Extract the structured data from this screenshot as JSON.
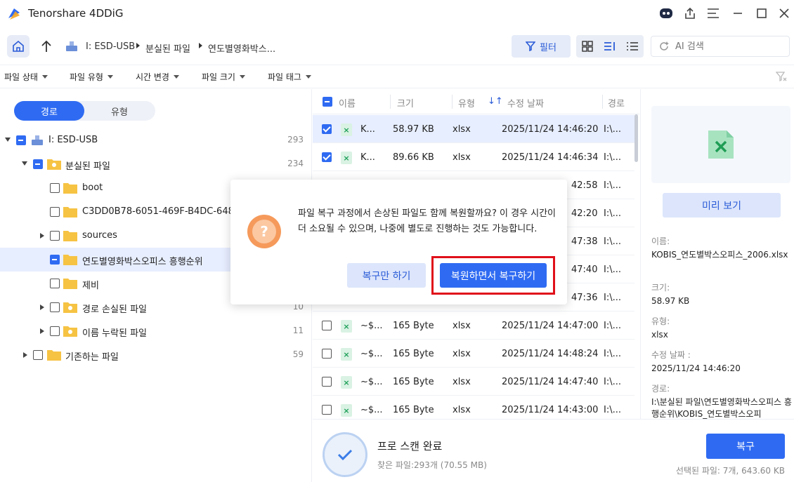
{
  "app": {
    "title": "Tenorshare 4DDiG"
  },
  "breadcrumb": {
    "drive": "I: ESD-USB",
    "folder": "분실된 파일",
    "current": "연도별영화박스..."
  },
  "toolbar": {
    "filter_label": "필터",
    "search_placeholder": "AI 검색"
  },
  "filters": [
    "파일 상태",
    "파일 유형",
    "시간 변경",
    "파일 크기",
    "파일 태그"
  ],
  "left": {
    "toggle": {
      "path": "경로",
      "type": "유형"
    },
    "tree": [
      {
        "label": "I: ESD-USB",
        "count": "293"
      },
      {
        "label": "분실된 파일",
        "count": "234"
      },
      {
        "label": "boot",
        "count": ""
      },
      {
        "label": "C3DD0B78-6051-469F-B4DC-6482",
        "count": ""
      },
      {
        "label": "sources",
        "count": ""
      },
      {
        "label": "연도별영화박스오피스 흥행순위",
        "count": ""
      },
      {
        "label": "제비",
        "count": ""
      },
      {
        "label": "경로 손실된 파일",
        "count": "10"
      },
      {
        "label": "이름 누락된 파일",
        "count": "11"
      },
      {
        "label": "기존하는 파일",
        "count": "59"
      }
    ]
  },
  "list": {
    "headers": {
      "name": "이름",
      "size": "크기",
      "type": "유형",
      "date": "수정 날짜",
      "path": "경로"
    },
    "rows": [
      {
        "name": "K...",
        "size": "58.97 KB",
        "type": "xlsx",
        "date": "2025/11/24 14:46:20",
        "path": "I:\\..."
      },
      {
        "name": "K...",
        "size": "89.66 KB",
        "type": "xlsx",
        "date": "2025/11/24 14:46:34",
        "path": "I:\\..."
      },
      {
        "name": "",
        "size": "",
        "type": "",
        "date": "42:58",
        "path": "I:\\..."
      },
      {
        "name": "",
        "size": "",
        "type": "",
        "date": "42:20",
        "path": "I:\\..."
      },
      {
        "name": "",
        "size": "",
        "type": "",
        "date": "47:38",
        "path": "I:\\..."
      },
      {
        "name": "",
        "size": "",
        "type": "",
        "date": "47:40",
        "path": "I:\\..."
      },
      {
        "name": "",
        "size": "",
        "type": "",
        "date": "47:36",
        "path": "I:\\..."
      },
      {
        "name": "~$...",
        "size": "165 Byte",
        "type": "xlsx",
        "date": "2025/11/24 14:47:00",
        "path": "I:\\..."
      },
      {
        "name": "~$...",
        "size": "165 Byte",
        "type": "xlsx",
        "date": "2025/11/24 14:48:24",
        "path": "I:\\..."
      },
      {
        "name": "~$...",
        "size": "165 Byte",
        "type": "xlsx",
        "date": "2025/11/24 14:47:40",
        "path": "I:\\..."
      },
      {
        "name": "~$...",
        "size": "165 Byte",
        "type": "xlsx",
        "date": "2025/11/24 14:43:00",
        "path": "I:\\..."
      }
    ]
  },
  "preview": {
    "button": "미리 보기",
    "name_label": "이름:",
    "name_value": "KOBIS_연도별박스오피스_2006.xlsx",
    "size_label": "크기:",
    "size_value": "58.97 KB",
    "type_label": "유형:",
    "type_value": "xlsx",
    "date_label": "수정 날짜 :",
    "date_value": "2025/11/24 14:46:20",
    "path_label": "경로:",
    "path_value": "I:\\분실된 파일\\연도별영화박스오피스 흥행순위\\KOBIS_연도별박스오피"
  },
  "bottom": {
    "status_title": "프로 스캔 완료",
    "status_sub": "찾은 파일:293개 (70.55 MB)",
    "recover_button": "복구",
    "selected_info": "선택된 파일: 7개, 643.60 KB"
  },
  "dialog": {
    "message": "파일 복구 과정에서 손상된 파일도 함께 복원할까요? 이 경우 시간이 더 소요될 수 있으며, 나중에 별도로 진행하는 것도 가능합니다.",
    "btn_recover_only": "복구만 하기",
    "btn_repair_recover": "복원하면서 복구하기"
  },
  "colors": {
    "accent": "#2f6bf2",
    "highlight_border": "#e0101a",
    "selection": "#e7eeff"
  }
}
